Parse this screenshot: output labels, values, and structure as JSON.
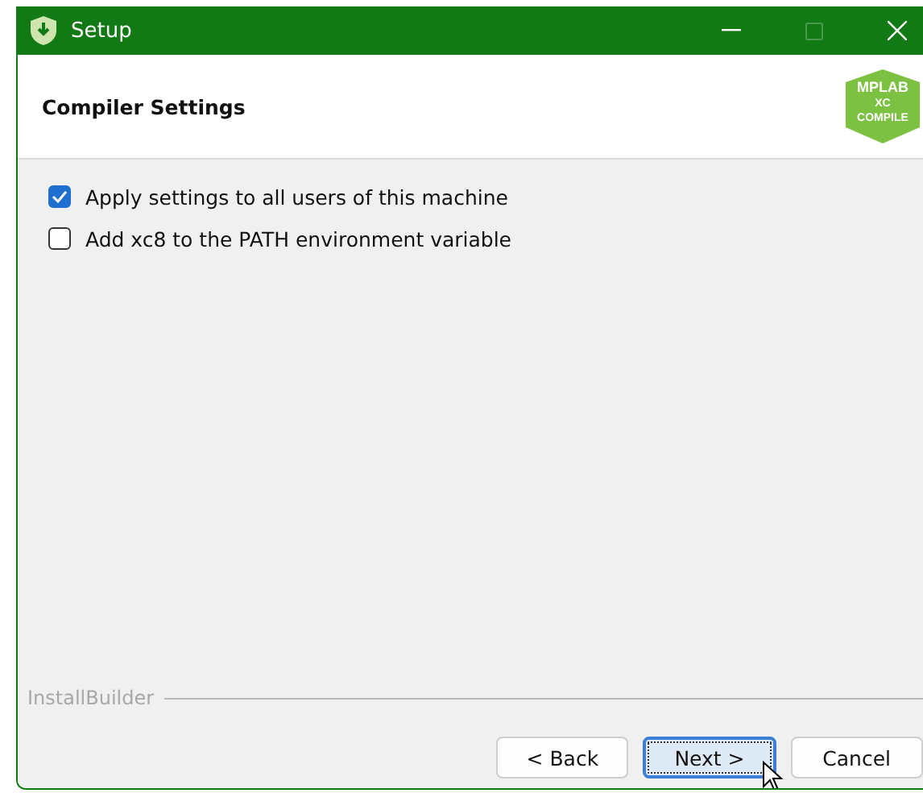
{
  "window": {
    "title": "Setup"
  },
  "header": {
    "title": "Compiler Settings",
    "logo_lines": [
      "MPLAB",
      "XC",
      "COMPILE"
    ]
  },
  "options": [
    {
      "label": "Apply settings to all users of this machine",
      "checked": true
    },
    {
      "label": "Add xc8 to the PATH environment variable",
      "checked": false
    }
  ],
  "footer": {
    "brand": "InstallBuilder"
  },
  "buttons": [
    {
      "label": "< Back",
      "default": false
    },
    {
      "label": "Next >",
      "default": true
    },
    {
      "label": "Cancel",
      "default": false
    }
  ]
}
